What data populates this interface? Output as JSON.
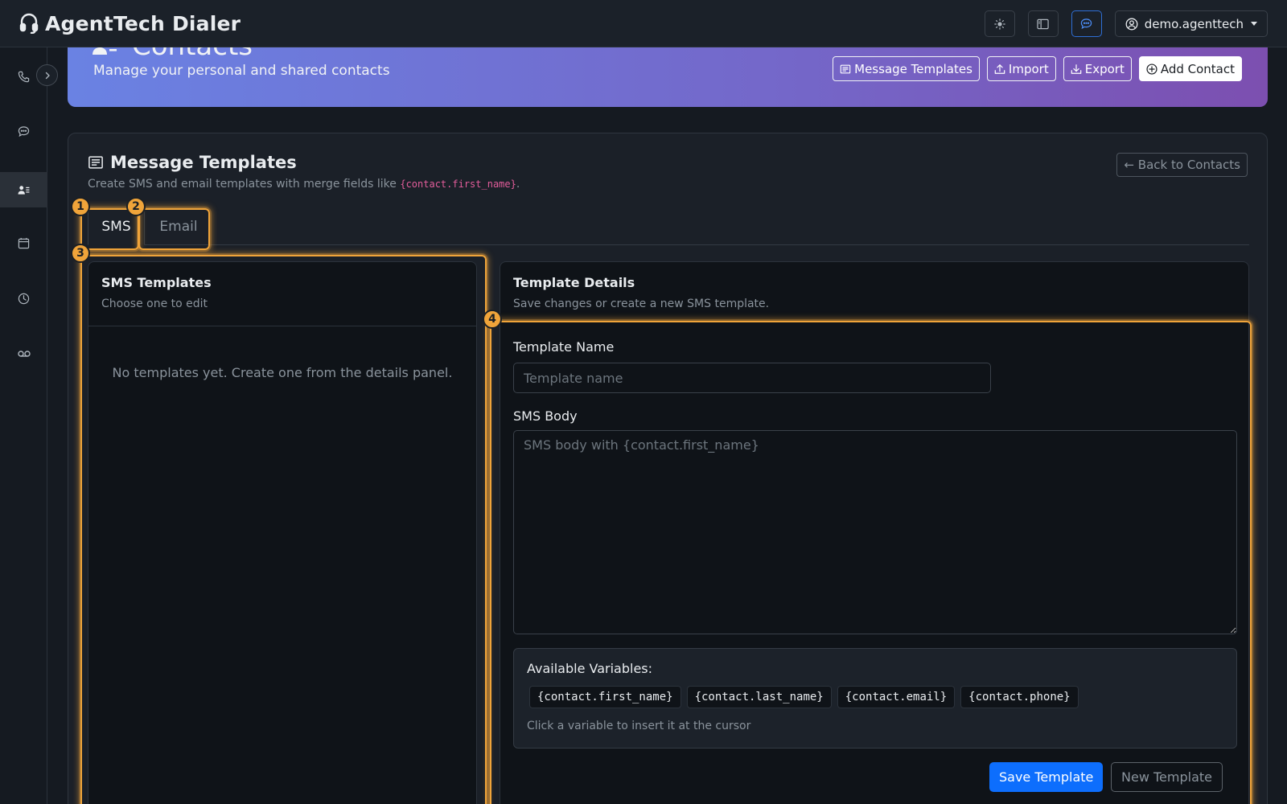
{
  "app": {
    "brand": "AgentTech Dialer",
    "user": "demo.agenttech",
    "topbar_icons": [
      "sun-icon",
      "sidebar-layout-icon",
      "chat-icon"
    ]
  },
  "sidebar": {
    "items": [
      {
        "name": "phone-icon",
        "active": false
      },
      {
        "name": "messages-icon",
        "active": false
      },
      {
        "name": "contacts-icon",
        "active": true
      },
      {
        "name": "calendar-icon",
        "active": false
      },
      {
        "name": "history-icon",
        "active": false
      },
      {
        "name": "voicemail-icon",
        "active": false
      }
    ],
    "toggle_icon": "chevron-right-icon"
  },
  "hero": {
    "title": "Contacts",
    "subtitle": "Manage your personal and shared contacts",
    "actions": {
      "message_templates": "Message Templates",
      "import": "Import",
      "export": "Export",
      "add_contact": "Add Contact"
    }
  },
  "templates": {
    "title": "Message Templates",
    "subtitle_prefix": "Create SMS and email templates with merge fields like ",
    "subtitle_code": "{contact.first_name}",
    "subtitle_suffix": ".",
    "back_button": "← Back to Contacts",
    "tabs": {
      "sms": "SMS",
      "email": "Email"
    },
    "active_tab": "sms",
    "list": {
      "title": "SMS Templates",
      "subtitle": "Choose one to edit",
      "empty": "No templates yet. Create one from the details panel."
    },
    "details": {
      "title": "Template Details",
      "subtitle": "Save changes or create a new SMS template.",
      "name_label": "Template Name",
      "name_placeholder": "Template name",
      "body_label": "SMS Body",
      "body_placeholder": "SMS body with {contact.first_name}",
      "variables_title": "Available Variables:",
      "variables": [
        "{contact.first_name}",
        "{contact.last_name}",
        "{contact.email}",
        "{contact.phone}"
      ],
      "variables_hint": "Click a variable to insert it at the cursor",
      "save_button": "Save Template",
      "new_button": "New Template"
    }
  },
  "annotations": [
    "1",
    "2",
    "3",
    "4"
  ],
  "colors": {
    "accent": "#0d6efd",
    "highlight": "#f0a43a",
    "hero_gradient_start": "#6a82e3",
    "hero_gradient_end": "#7c4fb0",
    "merge_code": "#e35d9b"
  }
}
